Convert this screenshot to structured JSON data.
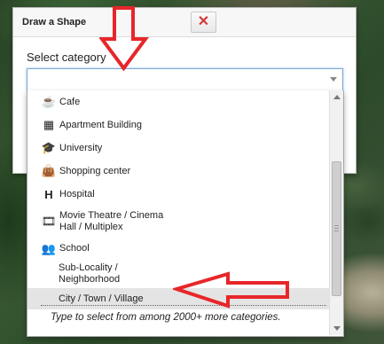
{
  "dialog": {
    "title": "Draw a Shape",
    "close_icon": "close-icon",
    "select_label": "Select category",
    "select_value": ""
  },
  "dropdown": {
    "items": [
      {
        "icon": "cafe-icon",
        "glyph": "☕",
        "label": "Cafe"
      },
      {
        "icon": "apartment-building-icon",
        "glyph": "▦",
        "label": "Apartment Building"
      },
      {
        "icon": "graduation-cap-icon",
        "glyph": "🎓",
        "label": "University"
      },
      {
        "icon": "shopping-bag-icon",
        "glyph": "👜",
        "label": "Shopping center"
      },
      {
        "icon": "hospital-icon",
        "glyph": "H",
        "label": "Hospital"
      },
      {
        "icon": "film-strip-icon",
        "glyph": "🎞",
        "label": "Movie Theatre / Cinema Hall / Multiplex"
      },
      {
        "icon": "school-children-icon",
        "glyph": "👥",
        "label": "School"
      },
      {
        "icon": "",
        "glyph": "",
        "label": "Sub-Locality / Neighborhood"
      },
      {
        "icon": "",
        "glyph": "",
        "label": "City / Town / Village"
      }
    ],
    "footer_text": "Type to select from among 2000+ more categories."
  },
  "annotations": {
    "arrow_color": "#e8262a"
  }
}
